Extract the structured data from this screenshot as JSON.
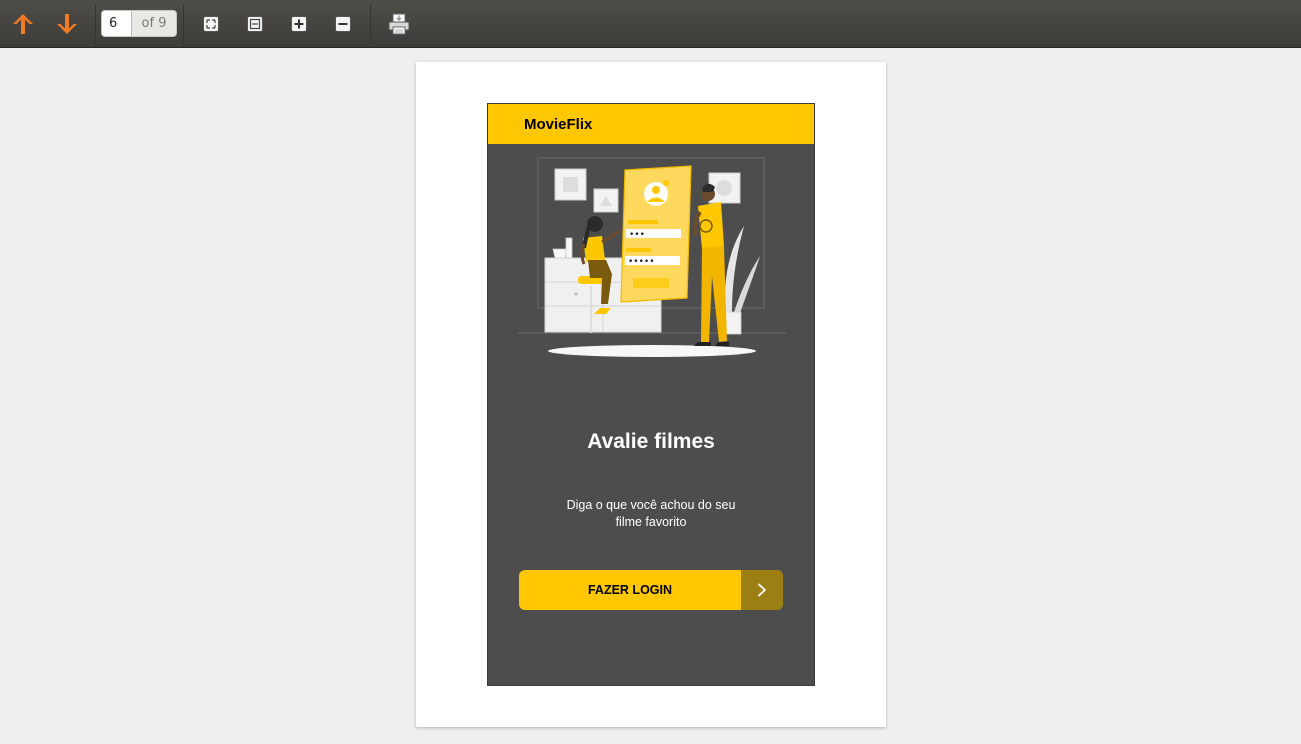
{
  "toolbar": {
    "icons": [
      "arrow-up-icon",
      "arrow-down-icon",
      "fit-page-icon",
      "fit-width-icon",
      "zoom-in-icon",
      "zoom-out-icon",
      "print-icon"
    ],
    "page_current": "6",
    "page_total_label": "of 9",
    "accent_color": "#f07b25"
  },
  "app": {
    "title": "MovieFlix",
    "headline": "Avalie filmes",
    "subtext_line1": "Diga o que você achou do seu",
    "subtext_line2": "filme favorito",
    "login_label": "FAZER LOGIN",
    "brand_color": "#ffc700",
    "screen_color": "#4d4d4d",
    "arrow_color": "#9c7f13"
  },
  "illustration": {
    "pin_dots": "•••",
    "password_dots": "•••••"
  }
}
